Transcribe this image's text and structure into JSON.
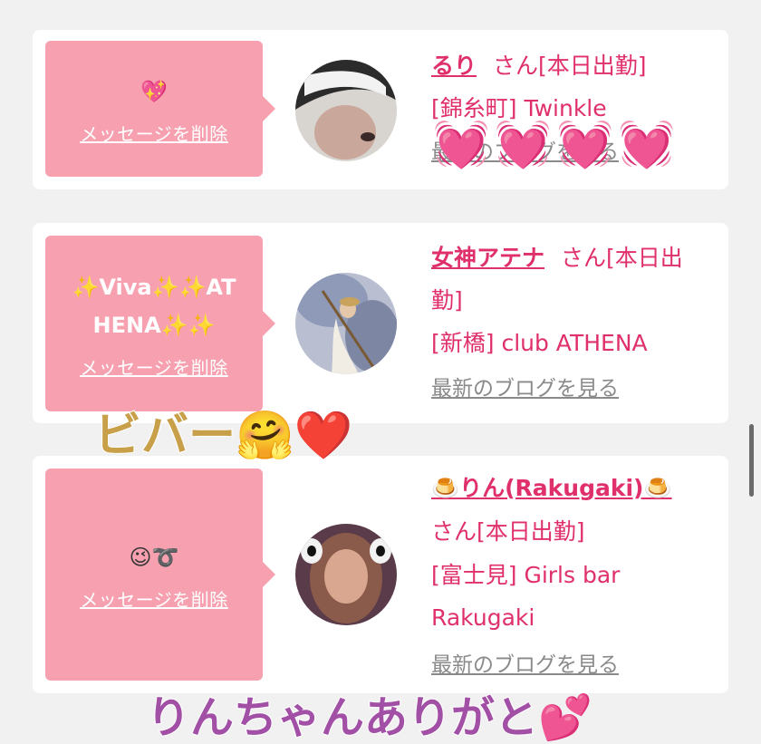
{
  "cards": [
    {
      "message": "💖",
      "delete_label": "メッセージを削除",
      "name": "るり",
      "suffix": "さん[本日出勤]",
      "shop": "[錦糸町] Twinkle",
      "blog_link": "最新のブログを見る"
    },
    {
      "message": "✨Viva✨✨ATHENA✨✨",
      "delete_label": "メッセージを削除",
      "name": "女神アテナ",
      "suffix": "さん[本日出勤]",
      "shop": "[新橋] club ATHENA",
      "blog_link": "最新のブログを見る"
    },
    {
      "message": "😉➰",
      "delete_label": "メッセージを削除",
      "name": "🍮りん(Rakugaki)🍮",
      "suffix": "さん[本日出勤]",
      "shop": "[富士見] Girls bar Rakugaki",
      "blog_link": "最新のブログを見る"
    }
  ],
  "overlays": {
    "hearts": "💓💓💓💓",
    "bieber": "ビバー🤗❤️",
    "thanks": "りんちゃんありがと💕"
  },
  "colors": {
    "bubble": "#f7a1b0",
    "accent": "#e0306c",
    "overlay_gold": "#c9a04a",
    "overlay_purple": "#a24fa6"
  }
}
